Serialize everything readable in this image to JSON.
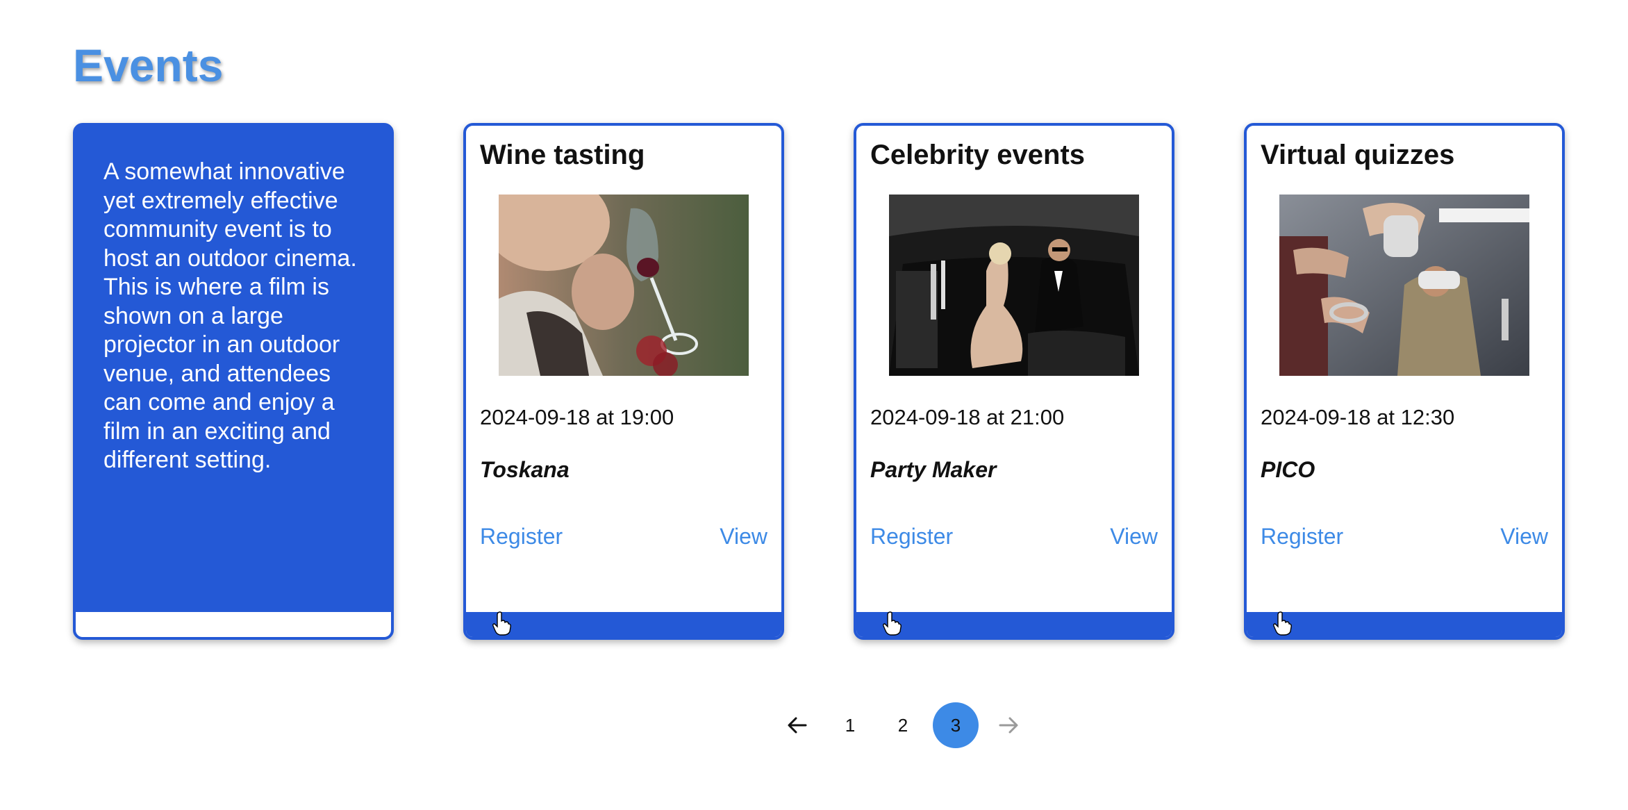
{
  "page": {
    "title": "Events"
  },
  "intro": {
    "text": "A somewhat innovative yet extremely effective community event is to host an outdoor cinema. This is where a film is shown on a large projector in an outdoor venue, and attendees can come and enjoy a film in an exciting and different setting."
  },
  "events": [
    {
      "title": "Wine tasting",
      "image_icon": "wine-tasting-photo",
      "datetime": "2024-09-18 at 19:00",
      "venue": "Toskana",
      "register_label": "Register",
      "view_label": "View"
    },
    {
      "title": "Celebrity events",
      "image_icon": "celebrity-limo-photo",
      "datetime": "2024-09-18 at 21:00",
      "venue": "Party Maker",
      "register_label": "Register",
      "view_label": "View"
    },
    {
      "title": "Virtual quizzes",
      "image_icon": "vr-headset-photo",
      "datetime": "2024-09-18 at 12:30",
      "venue": "PICO",
      "register_label": "Register",
      "view_label": "View"
    }
  ],
  "pagination": {
    "prev_icon": "arrow-left-icon",
    "next_icon": "arrow-right-icon",
    "pages": [
      "1",
      "2",
      "3"
    ],
    "current": "3",
    "next_disabled": true
  },
  "colors": {
    "accent": "#2459d6",
    "title": "#4a90e2",
    "link": "#3d8ae6",
    "active_page": "#3d8ae6",
    "disabled": "#9a9a9a"
  }
}
